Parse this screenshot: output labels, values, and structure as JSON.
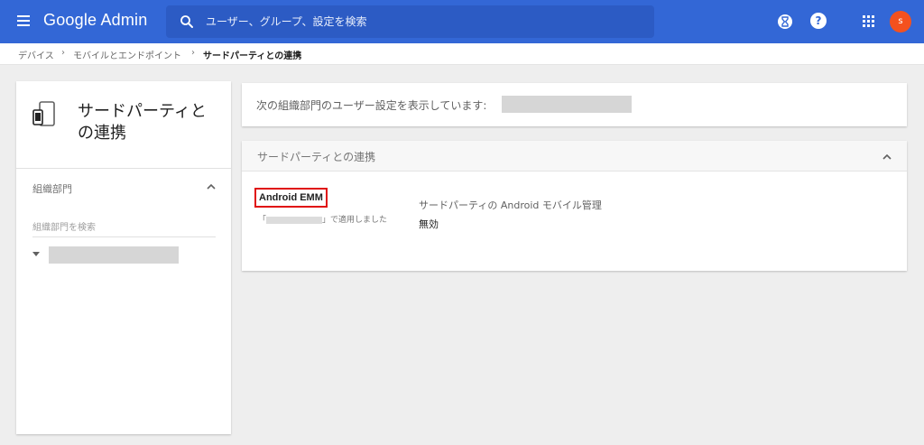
{
  "header": {
    "brand": "Google Admin",
    "search_placeholder": "ユーザー、グループ、設定を検索",
    "help_label": "?",
    "avatar_initial": "s"
  },
  "breadcrumb": {
    "items": [
      "デバイス",
      "モバイルとエンドポイント",
      "サードパーティとの連携"
    ],
    "separator": "›"
  },
  "sidebar": {
    "title": "サードパーティとの連携",
    "org_section_label": "組織部門",
    "org_search_placeholder": "組織部門を検索"
  },
  "main": {
    "org_notice": "次の組織部門のユーザー設定を表示しています:",
    "section_title": "サードパーティとの連携",
    "setting": {
      "name": "Android EMM",
      "applied_prefix": "「",
      "applied_suffix": "」で適用しました",
      "description": "サードパーティの Android モバイル管理",
      "value": "無効"
    }
  },
  "colors": {
    "topbar": "#3367d6",
    "avatar": "#f4511e",
    "highlight_border": "#e01010"
  }
}
